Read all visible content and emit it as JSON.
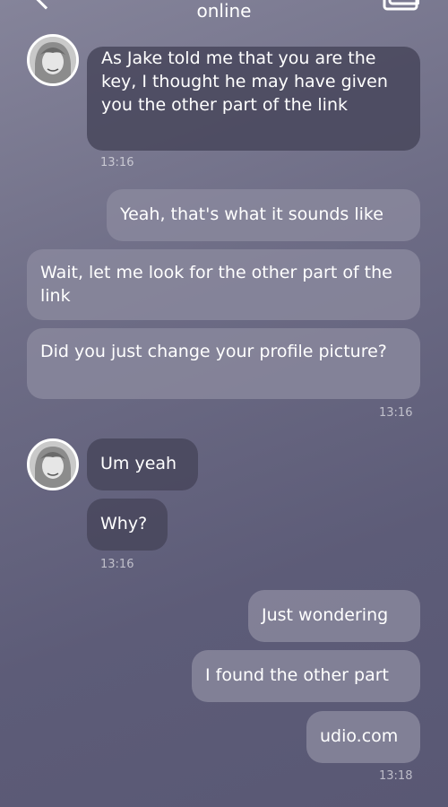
{
  "header": {
    "status": "online",
    "back_icon": "chevron-left-icon",
    "right_icon": "copy-icon"
  },
  "messages": [
    {
      "side": "in",
      "text": "As Jake told me that you are the key, I thought he may have given you the other part of the link",
      "time": "13:16"
    },
    {
      "side": "out",
      "text": "Yeah, that's what it sounds like"
    },
    {
      "side": "out",
      "text": "Wait, let me look for the other part of the link"
    },
    {
      "side": "out",
      "text": "Did you just change your profile picture?",
      "time": "13:16"
    },
    {
      "side": "in",
      "text": "Um yeah"
    },
    {
      "side": "in",
      "text": "Why?",
      "time": "13:16"
    },
    {
      "side": "out",
      "text": "Just wondering"
    },
    {
      "side": "out",
      "text": "I found the other part"
    },
    {
      "side": "out",
      "text": "udio.com",
      "time": "13:18"
    }
  ],
  "colors": {
    "incoming_bubble": "#48475c",
    "outgoing_bubble": "#8a899e"
  }
}
